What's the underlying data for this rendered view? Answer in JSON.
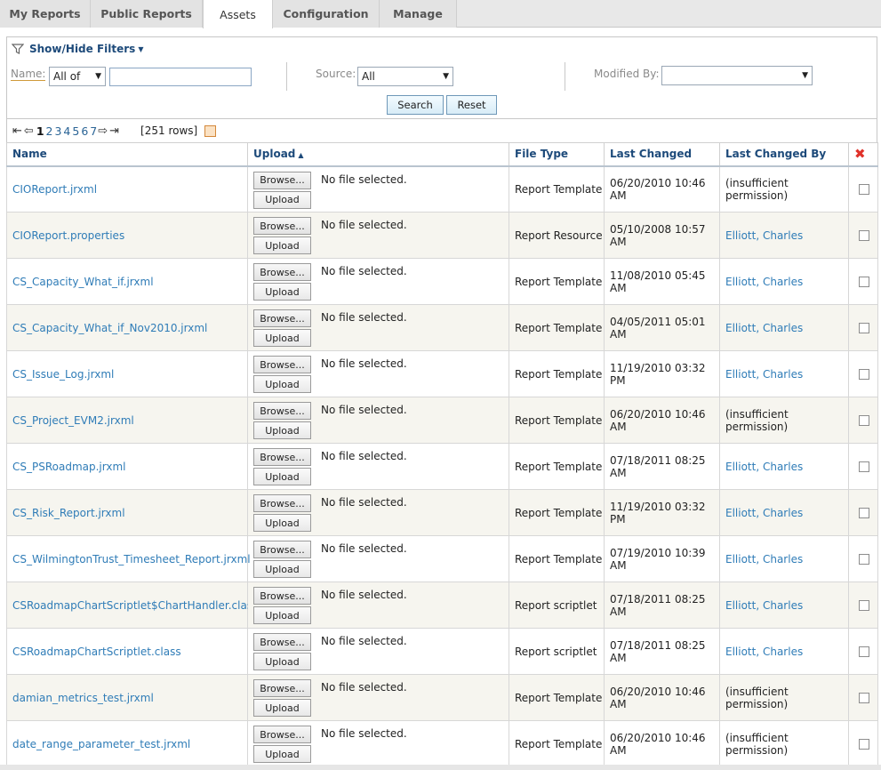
{
  "tabs": [
    "My Reports",
    "Public Reports",
    "Assets",
    "Configuration",
    "Manage"
  ],
  "filters": {
    "toggle_label": "Show/Hide Filters",
    "name_label": "Name:",
    "name_mode": "All of",
    "name_value": "",
    "source_label": "Source:",
    "source_value": "All",
    "modified_label": "Modified By:",
    "modified_value": "",
    "search_label": "Search",
    "reset_label": "Reset"
  },
  "pager": {
    "current": "1",
    "pages": [
      "2",
      "3",
      "4",
      "5",
      "6",
      "7"
    ],
    "rows": "[251 rows]"
  },
  "columns": {
    "name": "Name",
    "upload": "Upload",
    "file_type": "File Type",
    "last_changed": "Last Changed",
    "last_changed_by": "Last Changed By"
  },
  "upload": {
    "browse": "Browse...",
    "no_file": "No file selected.",
    "upload": "Upload"
  },
  "rows": [
    {
      "name": "CIOReport.jrxml",
      "type": "Report Template",
      "changed_1": "06/20/2010 10:46",
      "changed_2": "AM",
      "by_1": "(insufficient",
      "by_2": "permission)",
      "by_link": false
    },
    {
      "name": "CIOReport.properties",
      "type": "Report Resource",
      "changed_1": "05/10/2008 10:57",
      "changed_2": "AM",
      "by_1": "Elliott, Charles",
      "by_2": "",
      "by_link": true
    },
    {
      "name": "CS_Capacity_What_if.jrxml",
      "type": "Report Template",
      "changed_1": "11/08/2010 05:45",
      "changed_2": "AM",
      "by_1": "Elliott, Charles",
      "by_2": "",
      "by_link": true
    },
    {
      "name": "CS_Capacity_What_if_Nov2010.jrxml",
      "type": "Report Template",
      "changed_1": "04/05/2011 05:01",
      "changed_2": "AM",
      "by_1": "Elliott, Charles",
      "by_2": "",
      "by_link": true
    },
    {
      "name": "CS_Issue_Log.jrxml",
      "type": "Report Template",
      "changed_1": "11/19/2010 03:32",
      "changed_2": "PM",
      "by_1": "Elliott, Charles",
      "by_2": "",
      "by_link": true
    },
    {
      "name": "CS_Project_EVM2.jrxml",
      "type": "Report Template",
      "changed_1": "06/20/2010 10:46",
      "changed_2": "AM",
      "by_1": "(insufficient",
      "by_2": "permission)",
      "by_link": false
    },
    {
      "name": "CS_PSRoadmap.jrxml",
      "type": "Report Template",
      "changed_1": "07/18/2011 08:25",
      "changed_2": "AM",
      "by_1": "Elliott, Charles",
      "by_2": "",
      "by_link": true
    },
    {
      "name": "CS_Risk_Report.jrxml",
      "type": "Report Template",
      "changed_1": "11/19/2010 03:32",
      "changed_2": "PM",
      "by_1": "Elliott, Charles",
      "by_2": "",
      "by_link": true
    },
    {
      "name": "CS_WilmingtonTrust_Timesheet_Report.jrxml",
      "type": "Report Template",
      "changed_1": "07/19/2010 10:39",
      "changed_2": "AM",
      "by_1": "Elliott, Charles",
      "by_2": "",
      "by_link": true
    },
    {
      "name": "CSRoadmapChartScriptlet$ChartHandler.class",
      "type": "Report scriptlet",
      "changed_1": "07/18/2011 08:25",
      "changed_2": "AM",
      "by_1": "Elliott, Charles",
      "by_2": "",
      "by_link": true
    },
    {
      "name": "CSRoadmapChartScriptlet.class",
      "type": "Report scriptlet",
      "changed_1": "07/18/2011 08:25",
      "changed_2": "AM",
      "by_1": "Elliott, Charles",
      "by_2": "",
      "by_link": true
    },
    {
      "name": "damian_metrics_test.jrxml",
      "type": "Report Template",
      "changed_1": "06/20/2010 10:46",
      "changed_2": "AM",
      "by_1": "(insufficient",
      "by_2": "permission)",
      "by_link": false
    },
    {
      "name": "date_range_parameter_test.jrxml",
      "type": "Report Template",
      "changed_1": "06/20/2010 10:46",
      "changed_2": "AM",
      "by_1": "(insufficient",
      "by_2": "permission)",
      "by_link": false
    }
  ]
}
